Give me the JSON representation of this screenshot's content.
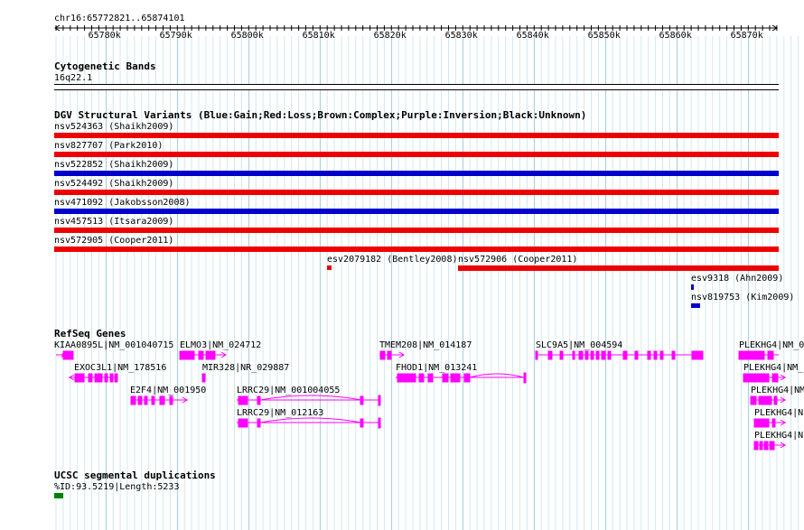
{
  "ruler": {
    "location": "chr16:65772821..65874101",
    "ticks": [
      "65780k",
      "65790k",
      "65800k",
      "65810k",
      "65820k",
      "65830k",
      "65840k",
      "65850k",
      "65860k",
      "65870k"
    ]
  },
  "cytoband": {
    "title": "Cytogenetic Bands",
    "band": "16q22.1"
  },
  "dgv": {
    "title": "DGV Structural Variants (Blue:Gain;Red:Loss;Brown:Complex;Purple:Inversion;Black:Unknown)",
    "variants": [
      {
        "label": "nsv524363 (Shaikh2009)",
        "color": "#ee0000"
      },
      {
        "label": "nsv827707 (Park2010)",
        "color": "#ee0000"
      },
      {
        "label": "nsv522852 (Shaikh2009)",
        "color": "#0000cc"
      },
      {
        "label": "nsv524492 (Shaikh2009)",
        "color": "#ee0000"
      },
      {
        "label": "nsv471092 (Jakobsson2008)",
        "color": "#0000cc"
      },
      {
        "label": "nsv457513 (Itsara2009)",
        "color": "#ee0000"
      },
      {
        "label": "nsv572905 (Cooper2011)",
        "color": "#ee0000"
      }
    ],
    "partial": [
      {
        "label": "esv2079182 (Bentley2008)",
        "color": "#ee0000"
      },
      {
        "label": "nsv572906 (Cooper2011)",
        "color": "#ee0000"
      },
      {
        "label": "esv9318 (Ahn2009)",
        "color": "#0000cc"
      },
      {
        "label": "nsv819753 (Kim2009)",
        "color": "#0000cc"
      }
    ]
  },
  "refseq": {
    "title": "RefSeq Genes",
    "color": "#ff00ff",
    "genes": [
      "KIAA0895L|NM_001040715",
      "EXOC3L1|NM_178516",
      "E2F4|NM_001950",
      "ELMO3|NM_024712",
      "MIR328|NR_029887",
      "LRRC29|NM_001004055",
      "LRRC29|NM_012163",
      "TMEM208|NM_014187",
      "FHOD1|NM_013241",
      "SLC9A5|NM_004594",
      "PLEKHG4|NM_0",
      "PLEKHG4|NM_",
      "PLEKHG4|NM",
      "PLEKHG4|N",
      "PLEKHG4|N"
    ]
  },
  "segdup": {
    "title": "UCSC segmental duplications",
    "item": "%ID:93.5219|Length:5233",
    "color": "#008000"
  }
}
